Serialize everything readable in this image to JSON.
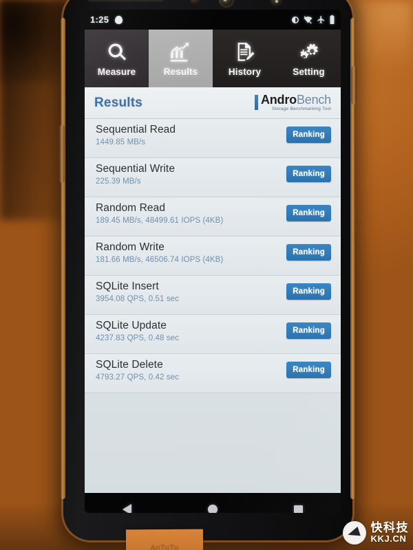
{
  "status_bar": {
    "time": "1:25",
    "notification_icon": "notification-dot-icon",
    "right_icons": [
      "do-not-disturb-icon",
      "wifi-off-icon",
      "airplane-mode-icon",
      "battery-icon"
    ]
  },
  "tabs": [
    {
      "label": "Measure",
      "icon": "magnifier-icon",
      "active": false
    },
    {
      "label": "Results",
      "icon": "bar-chart-icon",
      "active": true
    },
    {
      "label": "History",
      "icon": "document-pen-icon",
      "active": false
    },
    {
      "label": "Setting",
      "icon": "gears-icon",
      "active": false
    }
  ],
  "header": {
    "title": "Results",
    "logo_andro": "Andro",
    "logo_bench": "Bench",
    "logo_subtitle": "Storage Benchmarking Tool"
  },
  "results": [
    {
      "title": "Sequential Read",
      "value": "1449.85 MB/s",
      "button": "Ranking"
    },
    {
      "title": "Sequential Write",
      "value": "225.39 MB/s",
      "button": "Ranking"
    },
    {
      "title": "Random Read",
      "value": "189.45 MB/s, 48499.61 IOPS (4KB)",
      "button": "Ranking"
    },
    {
      "title": "Random Write",
      "value": "181.66 MB/s, 46506.74 IOPS (4KB)",
      "button": "Ranking"
    },
    {
      "title": "SQLite Insert",
      "value": "3954.08 QPS, 0.51 sec",
      "button": "Ranking"
    },
    {
      "title": "SQLite Update",
      "value": "4237.83 QPS, 0.48 sec",
      "button": "Ranking"
    },
    {
      "title": "SQLite Delete",
      "value": "4793.27 QPS, 0.42 sec",
      "button": "Ranking"
    }
  ],
  "nav_bar": {
    "back": "back-icon",
    "home": "home-icon",
    "recents": "recents-icon"
  },
  "watermark": {
    "cn": "快科技",
    "en": "KKJ.CN"
  },
  "colors": {
    "accent_blue": "#2b72ae",
    "title_blue": "#3d6f9e",
    "value_blue": "#6f90ae",
    "active_tab": "#b5b5b5",
    "background": "#b8651f"
  }
}
